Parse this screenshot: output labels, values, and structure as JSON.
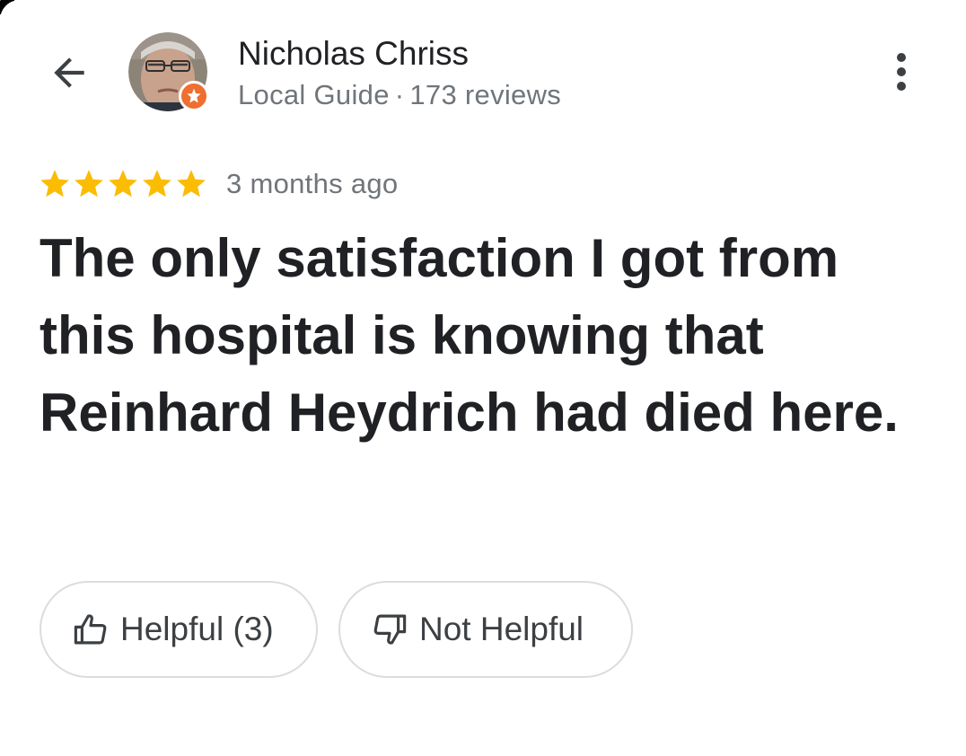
{
  "header": {
    "back_icon": "arrow-back-icon",
    "more_icon": "more-vertical-icon"
  },
  "reviewer": {
    "name": "Nicholas Chriss",
    "guide_label": "Local Guide",
    "separator": "·",
    "review_count": "173 reviews",
    "badge_icon": "local-guide-star-icon",
    "badge_color": "#ee6f30"
  },
  "review": {
    "rating": 5,
    "max_rating": 5,
    "star_color": "#fbbc04",
    "time_ago": "3 months ago",
    "text": "The only satisfaction I got from this hospital is knowing that Reinhard Heydrich had died here."
  },
  "actions": {
    "helpful_label": "Helpful (3)",
    "helpful_icon": "thumb-up-icon",
    "not_helpful_label": "Not Helpful",
    "not_helpful_icon": "thumb-down-icon"
  }
}
